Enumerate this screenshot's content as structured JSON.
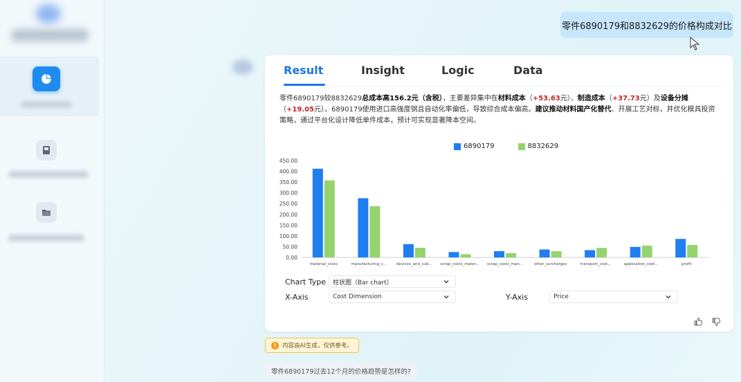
{
  "user_message": "零件6890179和8832629的价格构成对比",
  "tabs": [
    {
      "label": "Result"
    },
    {
      "label": "Insight"
    },
    {
      "label": "Logic"
    },
    {
      "label": "Data"
    }
  ],
  "summary": {
    "p1": "零件6890179较8832629",
    "p2": "总成本高156.2元（含税）",
    "p3": "，主要差异集中在",
    "p4": "材料成本",
    "p5": "（",
    "p6": "+53.63",
    "p7": "元）、",
    "p8": "制造成本",
    "p9": "（",
    "p10": "+37.73",
    "p11": "元）及",
    "p12": "设备分摊",
    "p13": "（",
    "p14": "+19.05",
    "p15": "元）。6890179使用进口高强度钢且自动化率偏低，导致综合成本偏高。",
    "p16": "建议推动材料国产化替代",
    "p17": "、开展工艺对标，并优化模具投资策略，通过平台化设计降低单件成本，预计可实现显著降本空间。"
  },
  "chart_data": {
    "type": "bar",
    "categories": [
      "material_costs",
      "manufacturing_c...",
      "devices_and_sub...",
      "scrap_costs_mater...",
      "scrap_costs_man...",
      "other_surcharges",
      "transport_cost...",
      "application_cost...",
      "profit"
    ],
    "series": [
      {
        "name": "6890179",
        "color": "#1f7ef0",
        "values": [
          412,
          275,
          62,
          25,
          29,
          37,
          34,
          49,
          86
        ]
      },
      {
        "name": "8832629",
        "color": "#95d36e",
        "values": [
          358,
          238,
          45,
          15,
          20,
          29,
          44,
          55,
          58
        ]
      }
    ],
    "yticks": [
      "0.00",
      "50.00",
      "100.00",
      "150.00",
      "200.00",
      "250.00",
      "300.00",
      "350.00",
      "400.00",
      "450.00"
    ],
    "ylim": [
      0,
      450
    ],
    "legend_position": "top"
  },
  "controls": {
    "chart_type_label": "Chart Type",
    "chart_type_value": "柱状图（Bar chart）",
    "x_axis_label": "X-Axis",
    "x_axis_value": "Cost Dimension",
    "y_axis_label": "Y-Axis",
    "y_axis_value": "Price"
  },
  "ai_note": "内容由AI生成，仅供参考。",
  "suggestion": "零件6890179过去12个月的价格趋势是怎样的?",
  "colors": {
    "accent": "#1f76e5",
    "red": "#c02626"
  }
}
